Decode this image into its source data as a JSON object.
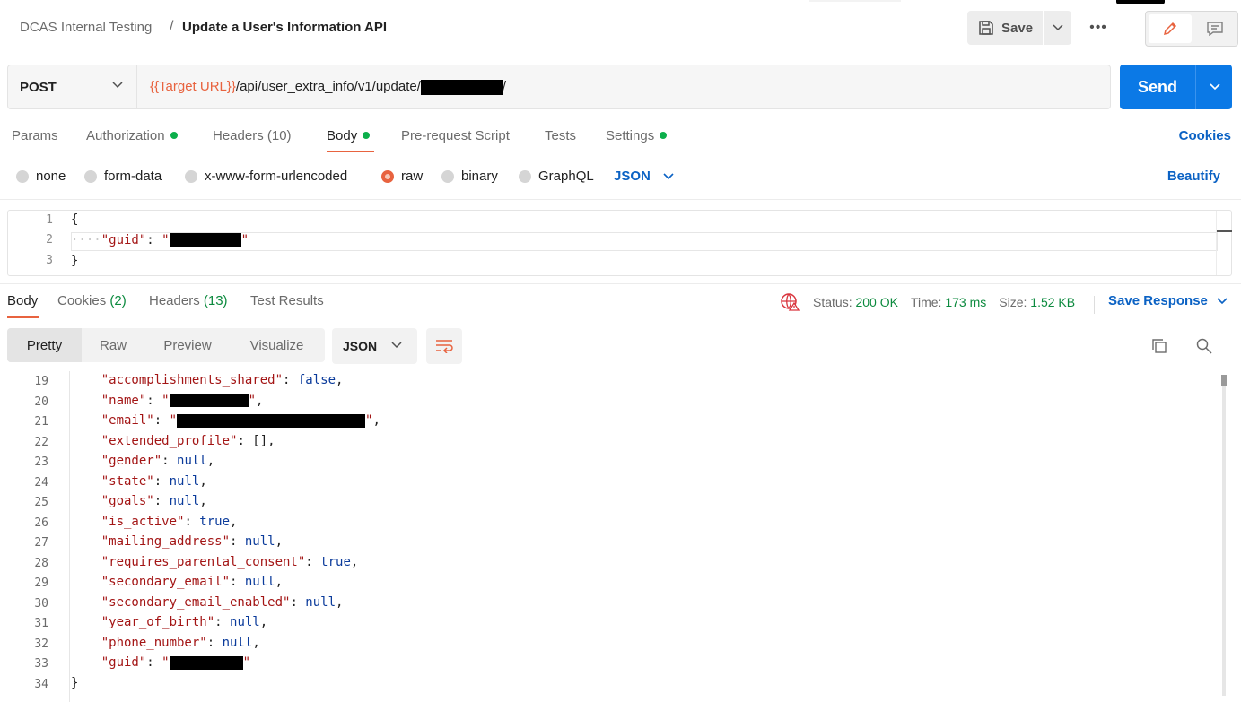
{
  "breadcrumb": {
    "parent": "DCAS Internal Testing",
    "separator": "/",
    "current": "Update a User's Information API"
  },
  "toolbar": {
    "save_label": "Save",
    "more_label": "•••"
  },
  "request": {
    "method": "POST",
    "url_variable": "{{Target URL}}",
    "url_path": "/api/user_extra_info/v1/update/",
    "url_suffix": "/",
    "send_label": "Send"
  },
  "request_tabs": [
    {
      "label": "Params",
      "count": "",
      "dot": false
    },
    {
      "label": "Authorization",
      "count": "",
      "dot": true
    },
    {
      "label": "Headers",
      "count": "(10)",
      "dot": false
    },
    {
      "label": "Body",
      "count": "",
      "dot": true,
      "active": true
    },
    {
      "label": "Pre-request Script",
      "count": "",
      "dot": false
    },
    {
      "label": "Tests",
      "count": "",
      "dot": false
    },
    {
      "label": "Settings",
      "count": "",
      "dot": true
    }
  ],
  "cookies_link": "Cookies",
  "body_options": {
    "radios": [
      "none",
      "form-data",
      "x-www-form-urlencoded",
      "raw",
      "binary",
      "GraphQL"
    ],
    "selected": "raw",
    "language": "JSON",
    "beautify_label": "Beautify"
  },
  "request_body": {
    "line_numbers": [
      "1",
      "2",
      "3"
    ],
    "open_brace": "{",
    "indent_dots": "····",
    "key": "\"guid\"",
    "colon": ": ",
    "close_brace": "}"
  },
  "response_tabs": {
    "body": "Body",
    "cookies": "Cookies",
    "cookies_count": "(2)",
    "headers": "Headers",
    "headers_count": "(13)",
    "test_results": "Test Results"
  },
  "response_status": {
    "status_label": "Status:",
    "status_value": "200 OK",
    "time_label": "Time:",
    "time_value": "173 ms",
    "size_label": "Size:",
    "size_value": "1.52 KB",
    "save_response": "Save Response"
  },
  "response_view": {
    "modes": [
      "Pretty",
      "Raw",
      "Preview",
      "Visualize"
    ],
    "active_mode": "Pretty",
    "format": "JSON"
  },
  "response_body": {
    "lines": [
      {
        "n": "19",
        "key": "\"accomplishments_shared\"",
        "val": "false",
        "type": "lit",
        "comma": ","
      },
      {
        "n": "20",
        "key": "\"name\"",
        "val": "",
        "type": "redact",
        "w": 88,
        "comma": ","
      },
      {
        "n": "21",
        "key": "\"email\"",
        "val": "",
        "type": "redact",
        "w": 210,
        "comma": ","
      },
      {
        "n": "22",
        "key": "\"extended_profile\"",
        "val": "[]",
        "type": "punc",
        "comma": ","
      },
      {
        "n": "23",
        "key": "\"gender\"",
        "val": "null",
        "type": "lit",
        "comma": ","
      },
      {
        "n": "24",
        "key": "\"state\"",
        "val": "null",
        "type": "lit",
        "comma": ","
      },
      {
        "n": "25",
        "key": "\"goals\"",
        "val": "null",
        "type": "lit",
        "comma": ","
      },
      {
        "n": "26",
        "key": "\"is_active\"",
        "val": "true",
        "type": "lit",
        "comma": ","
      },
      {
        "n": "27",
        "key": "\"mailing_address\"",
        "val": "null",
        "type": "lit",
        "comma": ","
      },
      {
        "n": "28",
        "key": "\"requires_parental_consent\"",
        "val": "true",
        "type": "lit",
        "comma": ","
      },
      {
        "n": "29",
        "key": "\"secondary_email\"",
        "val": "null",
        "type": "lit",
        "comma": ","
      },
      {
        "n": "30",
        "key": "\"secondary_email_enabled\"",
        "val": "null",
        "type": "lit",
        "comma": ","
      },
      {
        "n": "31",
        "key": "\"year_of_birth\"",
        "val": "null",
        "type": "lit",
        "comma": ","
      },
      {
        "n": "32",
        "key": "\"phone_number\"",
        "val": "null",
        "type": "lit",
        "comma": ","
      },
      {
        "n": "33",
        "key": "\"guid\"",
        "val": "",
        "type": "redact",
        "w": 82,
        "comma": ""
      }
    ],
    "last_line_number": "34",
    "close_brace": "}"
  },
  "colors": {
    "accent": "#e8633f",
    "primary": "#0b79e6",
    "link": "#0b62c4",
    "success": "#0caf4b"
  }
}
